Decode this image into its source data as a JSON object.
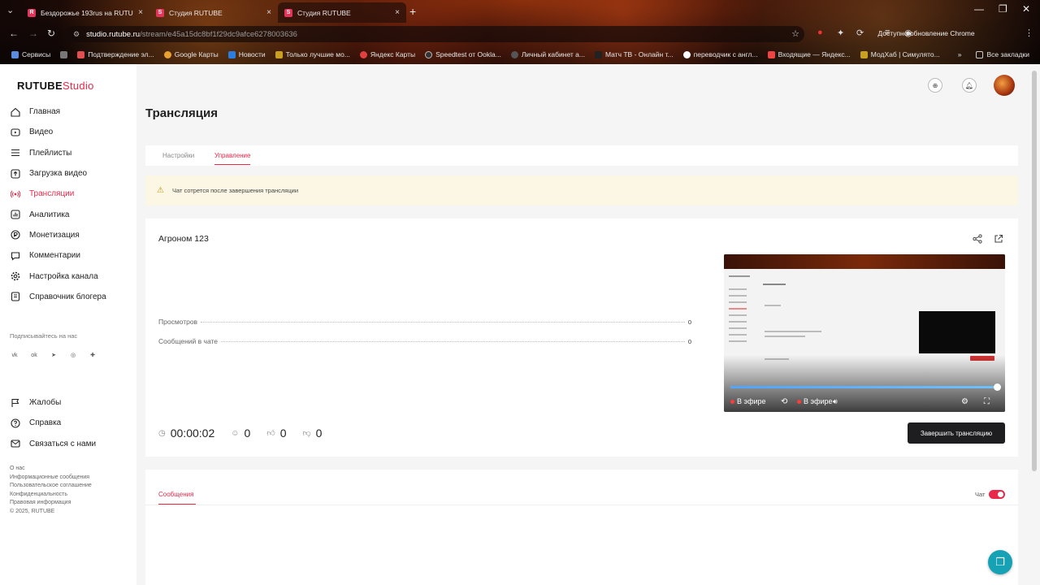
{
  "browser": {
    "tabs": [
      {
        "title": "Бездорожье 193rus на RUTUBE",
        "active": false
      },
      {
        "title": "Студия RUTUBE",
        "active": false
      },
      {
        "title": "Студия RUTUBE",
        "active": true
      }
    ],
    "url_host": "studio.rutube.ru",
    "url_path": "/stream/e45a15dc8bf1f29dc9afce6278003636",
    "update_label": "Доступно обновление Chrome",
    "bookmarks": [
      "Сервисы",
      "Подтверждение эл...",
      "Google Карты",
      "Новости",
      "Только лучшие мо...",
      "Яндекс Карты",
      "Speedtest от Ookla...",
      "Личный кабинет а...",
      "Матч ТВ - Онлайн т...",
      "переводчик с англ...",
      "Входящие — Яндекс...",
      "МодХаб | Симулято..."
    ],
    "all_bookmarks": "Все закладки"
  },
  "sidebar": {
    "logo_main": "RUTUBE",
    "logo_studio": "Studio",
    "items": [
      {
        "label": "Главная",
        "icon": "home-icon"
      },
      {
        "label": "Видео",
        "icon": "video-icon"
      },
      {
        "label": "Плейлисты",
        "icon": "playlist-icon"
      },
      {
        "label": "Загрузка видео",
        "icon": "upload-icon"
      },
      {
        "label": "Трансляции",
        "icon": "broadcast-icon",
        "active": true
      },
      {
        "label": "Аналитика",
        "icon": "analytics-icon"
      },
      {
        "label": "Монетизация",
        "icon": "money-icon"
      },
      {
        "label": "Комментарии",
        "icon": "comments-icon"
      },
      {
        "label": "Настройка канала",
        "icon": "settings-icon"
      },
      {
        "label": "Справочник блогера",
        "icon": "book-icon"
      }
    ],
    "subscribe_label": "Подписывайтесь на нас",
    "socials": [
      "vk",
      "ok",
      "telegram",
      "viber",
      "plus"
    ],
    "bottom_items": [
      {
        "label": "Жалобы",
        "icon": "flag-icon"
      },
      {
        "label": "Справка",
        "icon": "help-icon"
      },
      {
        "label": "Связаться с нами",
        "icon": "mail-icon"
      }
    ],
    "footer_links": [
      "О нас",
      "Информационные сообщения",
      "Пользовательское соглашение",
      "Конфиденциальность",
      "Правовая информация"
    ],
    "copyright": "© 2025, RUTUBE"
  },
  "page": {
    "title": "Трансляция",
    "tabs": [
      {
        "label": "Настройки",
        "active": false
      },
      {
        "label": "Управление",
        "active": true
      }
    ],
    "warning": "Чат сотрется после завершения трансляции"
  },
  "stream": {
    "name": "Агроном 123",
    "stats": [
      {
        "label": "Просмотров",
        "value": "0"
      },
      {
        "label": "Сообщений в чате",
        "value": "0"
      }
    ],
    "duration": "00:00:02",
    "viewers": "0",
    "likes": "0",
    "dislikes": "0",
    "player": {
      "live_label": "В эфире",
      "live_label_2": "В эфире",
      "progress": 1.0
    },
    "end_button": "Завершить трансляцию"
  },
  "messages": {
    "tab_label": "Сообщения",
    "chat_label": "Чат",
    "chat_enabled": true
  },
  "colors": {
    "accent": "#e8294a",
    "warning_bg": "#fcf7e4",
    "dark_button": "#1e1e21",
    "fab": "#16a2b4"
  }
}
